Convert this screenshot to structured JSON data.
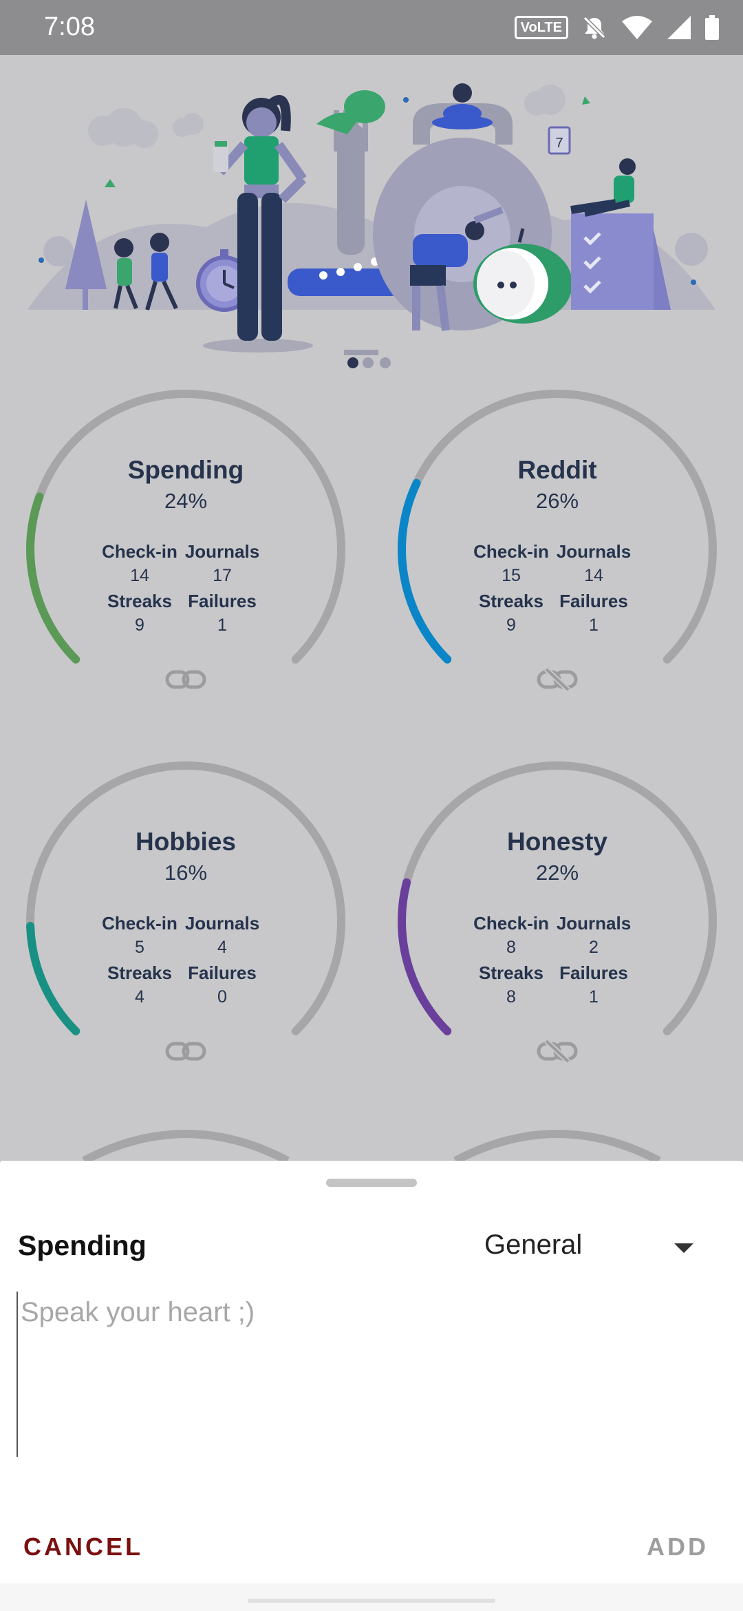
{
  "status_bar": {
    "time": "7:08",
    "volte": "VoLTE",
    "icons": [
      "volte-icon",
      "mute-icon",
      "wifi-icon",
      "signal-icon",
      "battery-icon"
    ]
  },
  "goals": [
    {
      "name": "Spending",
      "percent": "24%",
      "progress": 0.24,
      "color": "#5a9a56",
      "checkin_label": "Check-in",
      "checkin": "14",
      "journals_label": "Journals",
      "journals": "17",
      "streaks_label": "Streaks",
      "streaks": "9",
      "failures_label": "Failures",
      "failures": "1",
      "link_icon": "link-icon"
    },
    {
      "name": "Reddit",
      "percent": "26%",
      "progress": 0.26,
      "color": "#0a86c8",
      "checkin_label": "Check-in",
      "checkin": "15",
      "journals_label": "Journals",
      "journals": "14",
      "streaks_label": "Streaks",
      "streaks": "9",
      "failures_label": "Failures",
      "failures": "1",
      "link_icon": "link-off-icon"
    },
    {
      "name": "Hobbies",
      "percent": "16%",
      "progress": 0.16,
      "color": "#189184",
      "checkin_label": "Check-in",
      "checkin": "5",
      "journals_label": "Journals",
      "journals": "4",
      "streaks_label": "Streaks",
      "streaks": "4",
      "failures_label": "Failures",
      "failures": "0",
      "link_icon": "link-icon"
    },
    {
      "name": "Honesty",
      "percent": "22%",
      "progress": 0.22,
      "color": "#6a3f9c",
      "checkin_label": "Check-in",
      "checkin": "8",
      "journals_label": "Journals",
      "journals": "2",
      "streaks_label": "Streaks",
      "streaks": "8",
      "failures_label": "Failures",
      "failures": "1",
      "link_icon": "link-off-icon"
    }
  ],
  "sheet": {
    "title": "Spending",
    "category": "General",
    "placeholder": "Speak your heart ;)",
    "cancel_label": "CANCEL",
    "add_label": "ADD"
  }
}
